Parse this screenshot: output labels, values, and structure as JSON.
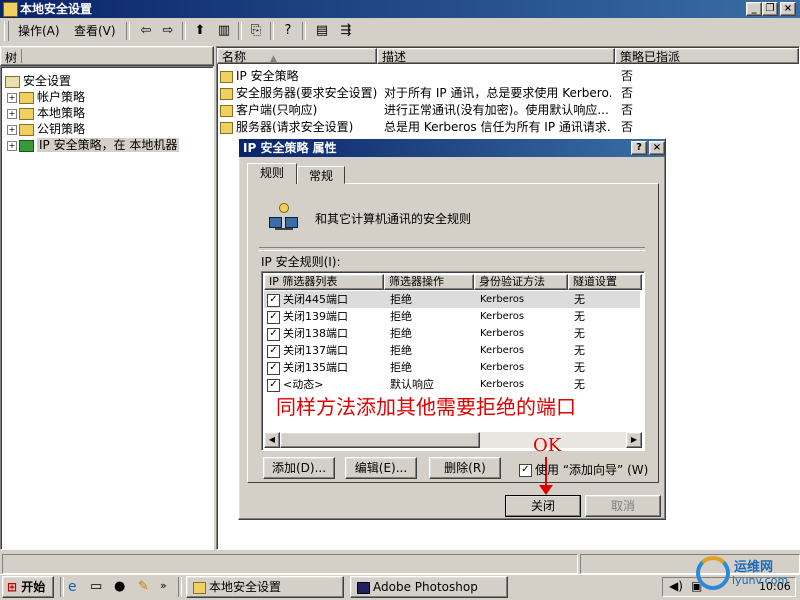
{
  "window": {
    "title": "本地安全设置"
  },
  "menu": {
    "action": "操作(A)",
    "view": "查看(V)"
  },
  "tree": {
    "header": "树",
    "items": [
      {
        "label": "安全设置"
      },
      {
        "label": "帐户策略"
      },
      {
        "label": "本地策略"
      },
      {
        "label": "公钥策略"
      },
      {
        "label": "IP 安全策略，在 本地机器"
      }
    ]
  },
  "list": {
    "columns": [
      "名称",
      "描述",
      "策略已指派"
    ],
    "rows": [
      {
        "name": "IP 安全策略",
        "desc": "",
        "assigned": "否"
      },
      {
        "name": "安全服务器(要求安全设置)",
        "desc": "对于所有 IP 通讯，总是要求使用 Kerbero...",
        "assigned": "否"
      },
      {
        "name": "客户端(只响应)",
        "desc": "进行正常通讯(没有加密)。使用默认响应...",
        "assigned": "否"
      },
      {
        "name": "服务器(请求安全设置)",
        "desc": "总是用 Kerberos 信任为所有 IP 通讯请求...",
        "assigned": "否"
      }
    ]
  },
  "dialog": {
    "title": "IP 安全策略 属性",
    "help": "?",
    "close": "×",
    "tabs": [
      "规则",
      "常规"
    ],
    "desc": "和其它计算机通讯的安全规则",
    "rules_label": "IP 安全规则(I):",
    "rule_columns": [
      "IP 筛选器列表",
      "筛选器操作",
      "身份验证方法",
      "隧道设置"
    ],
    "rules": [
      {
        "filter": "关闭445端口",
        "action": "拒绝",
        "auth": "Kerberos",
        "tunnel": "无"
      },
      {
        "filter": "关闭139端口",
        "action": "拒绝",
        "auth": "Kerberos",
        "tunnel": "无"
      },
      {
        "filter": "关闭138端口",
        "action": "拒绝",
        "auth": "Kerberos",
        "tunnel": "无"
      },
      {
        "filter": "关闭137端口",
        "action": "拒绝",
        "auth": "Kerberos",
        "tunnel": "无"
      },
      {
        "filter": "关闭135端口",
        "action": "拒绝",
        "auth": "Kerberos",
        "tunnel": "无"
      },
      {
        "filter": "<动态>",
        "action": "默认响应",
        "auth": "Kerberos",
        "tunnel": "无"
      }
    ],
    "annotation": "同样方法添加其他需要拒绝的端口",
    "ok_note": "OK",
    "buttons": {
      "add": "添加(D)...",
      "edit": "编辑(E)...",
      "remove": "删除(R)"
    },
    "wizard_label": "使用 “添加向导” (W)",
    "close_btn": "关闭",
    "cancel_btn": "取消"
  },
  "taskbar": {
    "start": "开始",
    "tasks": [
      "本地安全设置",
      "Adobe Photoshop"
    ],
    "clock": "10:06"
  },
  "watermark": {
    "site": "运维网",
    "url": "iyunv.com"
  },
  "colors": {
    "annotation": "#e00000",
    "titlebar": "#0a246a",
    "highlight": "#0a246a"
  }
}
